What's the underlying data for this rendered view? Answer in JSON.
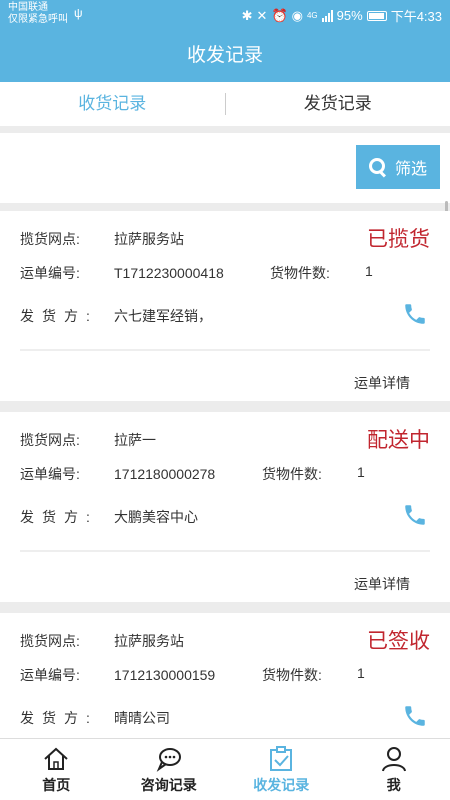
{
  "statusbar": {
    "carrier_line1": "中国联通",
    "carrier_line2": "仅限紧急呼叫",
    "usb_icon": "ψ",
    "network": "4G",
    "battery": "95%",
    "time": "下午4:33"
  },
  "header": {
    "title": "收发记录"
  },
  "tabs": [
    {
      "label": "收货记录",
      "active": true
    },
    {
      "label": "发货记录",
      "active": false
    }
  ],
  "filter": {
    "label": "筛选"
  },
  "labels": {
    "station": "揽货网点:",
    "waybill": "运单编号:",
    "count": "货物件数:",
    "shipper": "发货方:",
    "detail": "运单详情"
  },
  "records": [
    {
      "station": "拉萨服务站",
      "waybill": "T1712230000418",
      "count": "1",
      "shipper": "六七建军经销，",
      "status": "已揽货"
    },
    {
      "station": "拉萨一",
      "waybill": "1712180000278",
      "count": "1",
      "shipper": "大鹏美容中心",
      "status": "配送中"
    },
    {
      "station": "拉萨服务站",
      "waybill": "1712130000159",
      "count": "1",
      "shipper": "晴晴公司",
      "status": "已签收"
    }
  ],
  "nav": [
    {
      "label": "首页",
      "icon": "home-icon"
    },
    {
      "label": "咨询记录",
      "icon": "chat-icon"
    },
    {
      "label": "收发记录",
      "icon": "clipboard-check-icon",
      "active": true
    },
    {
      "label": "我",
      "icon": "user-icon"
    }
  ],
  "colors": {
    "primary": "#5ab4e0",
    "status_red": "#c1262f"
  }
}
